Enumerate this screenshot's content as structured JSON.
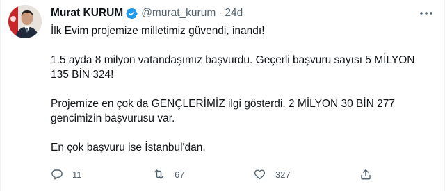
{
  "tweet": {
    "author_name": "Murat KURUM",
    "author_handle": "@murat_kurum",
    "separator": "·",
    "time": "24d",
    "paragraphs": [
      "İlk Evim projemize milletimiz güvendi, inandı!",
      "1.5 ayda 8 milyon vatandaşımız başvurdu. Geçerli başvuru sayısı 5 MİLYON 135 BİN 324!",
      "Projemize en çok da GENÇLERİMİZ ilgi gösterdi. 2 MİLYON 30 BİN 277 gencimizin başvurusu var.",
      "En çok başvuru ise İstanbul'dan."
    ],
    "replies": "11",
    "retweets": "67",
    "likes": "327"
  },
  "icons": {
    "verified": "verified-badge-icon",
    "more": "more-dots-icon",
    "reply": "reply-icon",
    "retweet": "retweet-icon",
    "like": "heart-icon",
    "share": "share-icon"
  },
  "colors": {
    "text": "#0f1419",
    "secondary": "#536471",
    "verified": "#1d9bf0"
  }
}
